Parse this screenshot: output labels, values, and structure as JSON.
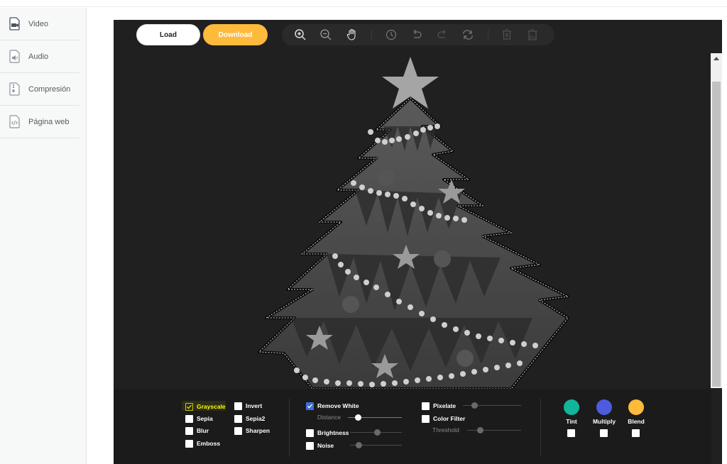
{
  "sidebar": {
    "items": [
      {
        "label": "Video",
        "icon": "video-file-icon"
      },
      {
        "label": "Audio",
        "icon": "audio-file-icon"
      },
      {
        "label": "Compresión",
        "icon": "zip-file-icon"
      },
      {
        "label": "Página web",
        "icon": "code-file-icon"
      }
    ]
  },
  "toolbar": {
    "load_label": "Load",
    "download_label": "Download",
    "icons": [
      "zoom-in-icon",
      "zoom-out-icon",
      "hand-pan-icon",
      "history-icon",
      "undo-icon",
      "redo-icon",
      "reset-icon",
      "delete-icon",
      "delete-all-icon"
    ]
  },
  "filters": {
    "col1": [
      {
        "label": "Grayscale",
        "checked": true,
        "highlighted": true
      },
      {
        "label": "Sepia",
        "checked": false
      },
      {
        "label": "Blur",
        "checked": false
      },
      {
        "label": "Emboss",
        "checked": false
      }
    ],
    "col2": [
      {
        "label": "Invert",
        "checked": false
      },
      {
        "label": "Sepia2",
        "checked": false
      },
      {
        "label": "Sharpen",
        "checked": false
      }
    ],
    "remove_white": {
      "label": "Remove White",
      "checked": true,
      "sub_label": "Distance"
    },
    "brightness": {
      "label": "Brightness",
      "checked": false
    },
    "noise": {
      "label": "Noise",
      "checked": false
    },
    "pixelate": {
      "label": "Pixelate",
      "checked": false
    },
    "color_filter": {
      "label": "Color Filter",
      "checked": false,
      "sub_label": "Threshold"
    },
    "colors": [
      {
        "label": "Tint",
        "color": "#13b59a",
        "checked": false
      },
      {
        "label": "Multiply",
        "color": "#4c5be0",
        "checked": false
      },
      {
        "label": "Blend",
        "color": "#fdba3b",
        "checked": false
      }
    ]
  },
  "colors": {
    "accent": "#fdba3b",
    "editor_bg": "#202020",
    "checked_blue": "#3d6fd6"
  }
}
